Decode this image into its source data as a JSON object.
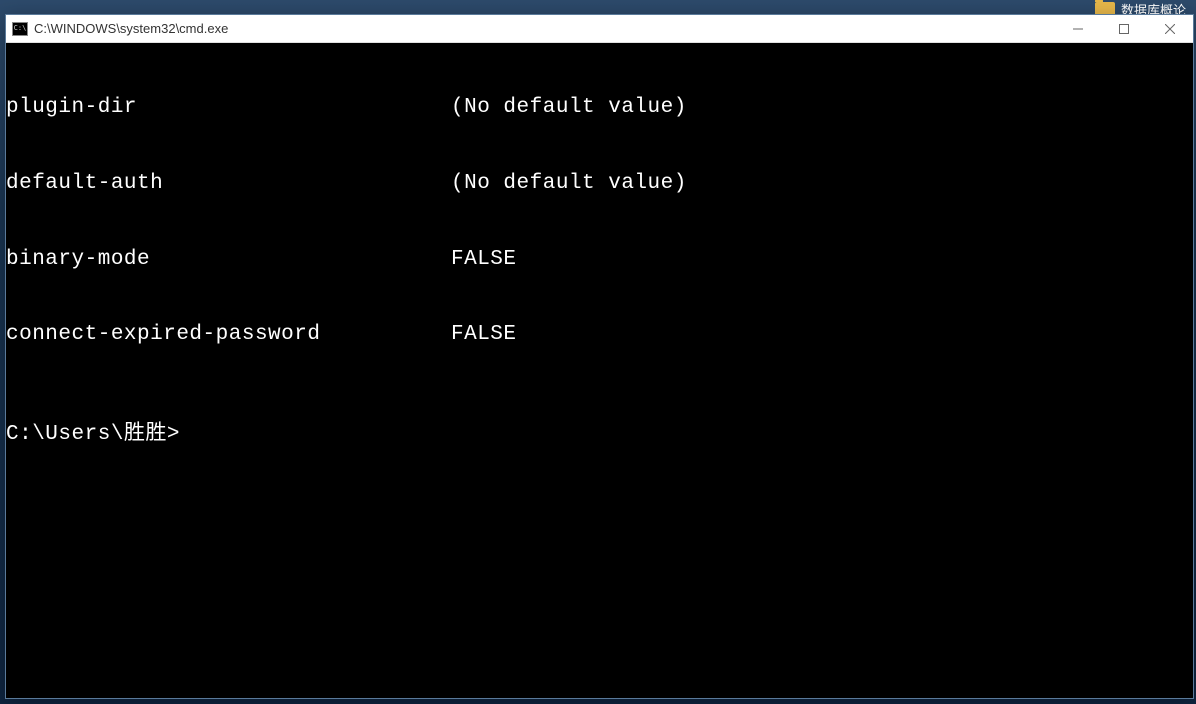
{
  "desktop": {
    "icon_label": "数据库概论"
  },
  "window": {
    "title": "C:\\WINDOWS\\system32\\cmd.exe",
    "icon_text": "C:\\"
  },
  "terminal": {
    "rows": [
      {
        "key": "plugin-dir",
        "value": "(No default value)"
      },
      {
        "key": "default-auth",
        "value": "(No default value)"
      },
      {
        "key": "binary-mode",
        "value": "FALSE"
      },
      {
        "key": "connect-expired-password",
        "value": "FALSE"
      }
    ],
    "prompt": "C:\\Users\\胜胜>"
  }
}
